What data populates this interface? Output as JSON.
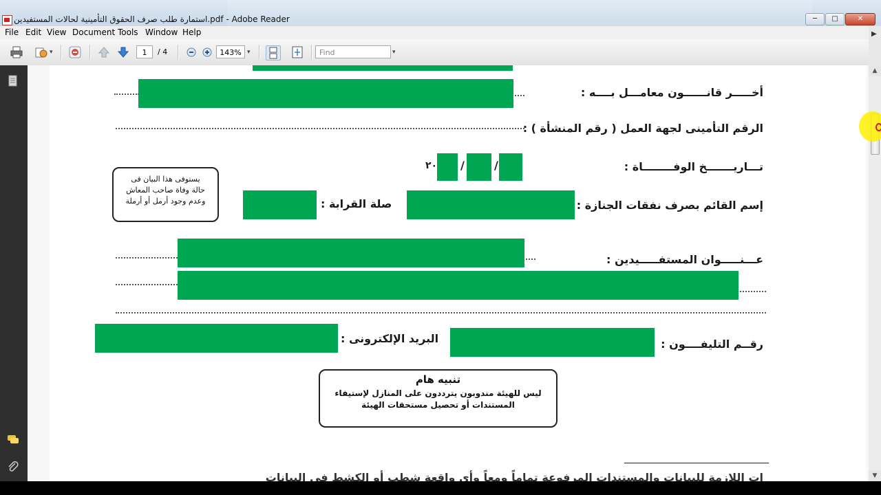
{
  "window": {
    "title": "استمارة طلب صرف الحقوق التأمينية لحالات المستفيدين.pdf - Adobe Reader"
  },
  "menu": [
    "File",
    "Edit",
    "View",
    "Document",
    "Tools",
    "Window",
    "Help"
  ],
  "toolbar": {
    "page_current": "1",
    "page_total": "/ 4",
    "zoom": "143%",
    "find_placeholder": "Find"
  },
  "document": {
    "label_last_law": "أخـــــر قانــــــون معامـــل بــــه :",
    "label_insurance_number": "الرقم التأمينى لجهة العمل ( رقم المنشأة ) :",
    "label_death_date": "تـــاريـــــــخ الوفــــــــاة :",
    "date_separator": "/",
    "date_year_prefix": "٢٠",
    "label_funeral_payee": "إسم القائم بصرف نفقات الجنازة :",
    "label_relation": "صلة القرابة :",
    "label_address": "عـــنـــــوان المستفـــــيدين :",
    "label_phone": "رقــم التليفــــون :",
    "label_email": "البريد الإلكترونى :",
    "side_note": [
      "يستوفى هذا البيان فى",
      "حالة وفاة صاحب المعاش",
      "وعدم وجود أرمل أو أرملة"
    ],
    "notice_title": "تنبيه هام",
    "notice_lines": [
      "ليس للهيئة مندوبون يترددون على المنازل لإستيفاء",
      "المستندات أو تحصيل مستحقات الهيئة"
    ],
    "bottom_fragment": "ات اللازمة للبيانات والمستندات المرفوعة تماماً ومعاً وأي واقعة شطب أو الكشط في البيانات"
  },
  "colors": {
    "redaction": "#00a651",
    "viewer_bg": "#f7f7f7",
    "sidebar_bg": "#2f2f2f"
  }
}
